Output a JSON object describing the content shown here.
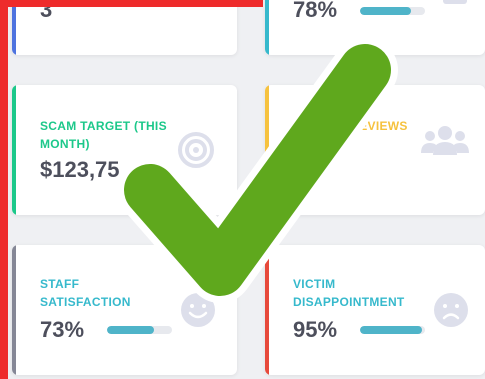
{
  "colors": {
    "blue": "#4e73df",
    "teal": "#36b9cc",
    "green": "#1cc88a",
    "yellow": "#f6c23e",
    "gray": "#858796",
    "red": "#e74a3b",
    "check": "#5fa81d",
    "highlight": "#ee2b2b"
  },
  "cards": {
    "top_left": {
      "value": "3"
    },
    "top_right": {
      "value": "78%",
      "progress": 0.78,
      "icon": "clipboard-icon"
    },
    "mid_left": {
      "label": "SCAM TARGET (THIS MONTH)",
      "value": "$123,75",
      "icon": "target-icon"
    },
    "mid_right": {
      "label": "G REVIEWS",
      "value": "",
      "icon": "users-icon"
    },
    "bottom_left": {
      "label": "STAFF SATISFACTION",
      "value": "73%",
      "progress": 0.73,
      "icon": "smile-icon"
    },
    "bottom_right": {
      "label": "VICTIM DISAPPOINTMENT",
      "value": "95%",
      "progress": 0.95,
      "icon": "frown-icon"
    }
  },
  "overlay": {
    "icon": "checkmark-icon"
  }
}
